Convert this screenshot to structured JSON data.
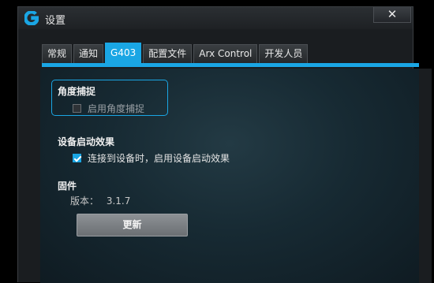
{
  "window": {
    "title": "设置",
    "close_label": "✕"
  },
  "tabs": [
    {
      "label": "常规"
    },
    {
      "label": "通知"
    },
    {
      "label": "G403",
      "active": true
    },
    {
      "label": "配置文件"
    },
    {
      "label": "Arx Control"
    },
    {
      "label": "开发人员"
    }
  ],
  "angle_snapping": {
    "title": "角度捕捉",
    "checkbox_label": "启用角度捕捉",
    "checked": false
  },
  "startup_effect": {
    "title": "设备启动效果",
    "checkbox_label": "连接到设备时，启用设备启动效果",
    "checked": true
  },
  "firmware": {
    "title": "固件",
    "version_label": "版本：",
    "version_value": "3.1.7",
    "update_label": "更新"
  },
  "colors": {
    "accent": "#1aa6e4"
  },
  "icons": {
    "app": "logitech-g-icon",
    "close": "close-icon",
    "check": "check-icon"
  }
}
